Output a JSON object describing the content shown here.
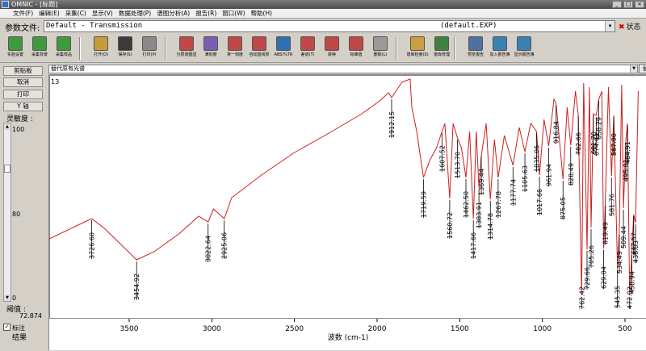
{
  "window": {
    "title": "OMNIC - [标题]"
  },
  "menu": [
    "文件(F)",
    "编辑(E)",
    "采集(C)",
    "显示(V)",
    "数据处理(P)",
    "谱图分析(A)",
    "报告(R)",
    "窗口(W)",
    "帮助(H)"
  ],
  "params": {
    "label": "参数文件:",
    "value": "Default - Transmission",
    "file": "(default.EXP)",
    "status": "状态"
  },
  "toolbar": [
    {
      "label": "实验设置",
      "color": "#3f9a3f"
    },
    {
      "label": "采集背景",
      "color": "#3f9a3f"
    },
    {
      "label": "采集样品",
      "color": "#3f9a3f"
    },
    {
      "label": "打开(O)",
      "color": "#c79a3a"
    },
    {
      "label": "保存(S)",
      "color": "#3a3a3a"
    },
    {
      "label": "打印(P)",
      "color": "#8a8a8a"
    },
    {
      "label": "分层谱图显",
      "color": "#c04848"
    },
    {
      "label": "满刻度",
      "color": "#7a5fb0"
    },
    {
      "label": "常一刻度",
      "color": "#c04848"
    },
    {
      "label": "自动基线校",
      "color": "#c04848"
    },
    {
      "label": "ABS/%TR",
      "color": "#3070b0"
    },
    {
      "label": "差谱(T)",
      "color": "#c04848"
    },
    {
      "label": "转换",
      "color": "#c04848"
    },
    {
      "label": "标峰值",
      "color": "#c04848"
    },
    {
      "label": "删除(L)",
      "color": "#9a9a9a"
    },
    {
      "label": "谱库检索(S)",
      "color": "#c8a040"
    },
    {
      "label": "谱库管理",
      "color": "#408040"
    },
    {
      "label": "预览报告",
      "color": "#5070a0"
    },
    {
      "label": "加入报告簿",
      "color": "#3a80b0"
    },
    {
      "label": "显示报告簿",
      "color": "#3a80b0"
    }
  ],
  "spectrum_selector": {
    "value": "替代原有光谱",
    "button": "替代"
  },
  "left_buttons": [
    "剪贴板",
    "取消",
    "打印",
    "Y 轴"
  ],
  "sensitivity": {
    "label": "灵敏度 :",
    "max": "100",
    "value": "80",
    "min": "0"
  },
  "threshold": {
    "label": "阈值 :",
    "value": "72.874"
  },
  "checkbox": {
    "label": "标注",
    "checked": true
  },
  "results_label": "结果",
  "plot": {
    "spectrum_number": "13",
    "line_color": "#cc2020",
    "x_axis_label": "波数 (cm-1)",
    "x_ticks": [
      "3500",
      "3000",
      "2500",
      "2000",
      "1500",
      "1000",
      "500"
    ],
    "peak_labels": [
      "3726.60",
      "3454.92",
      "3022.64",
      "2925.06",
      "1912.15",
      "1719.59",
      "1607.52",
      "1560.72",
      "1513.70",
      "1462.50",
      "1417.66",
      "1383.91",
      "1369.44",
      "1314.78",
      "1267.78",
      "1177.74",
      "1105.63",
      "1017.66",
      "1035.06",
      "961.94",
      "916.84",
      "875.05",
      "828.49",
      "782.66",
      "762.42",
      "729.66",
      "705.26",
      "691.70",
      "674.41",
      "658.29",
      "629.04",
      "619.49",
      "581.76",
      "567.90",
      "545.35",
      "534.49",
      "509.44",
      "495.01",
      "484.91",
      "472.02",
      "458.94",
      "447.57",
      "436.03"
    ]
  }
}
